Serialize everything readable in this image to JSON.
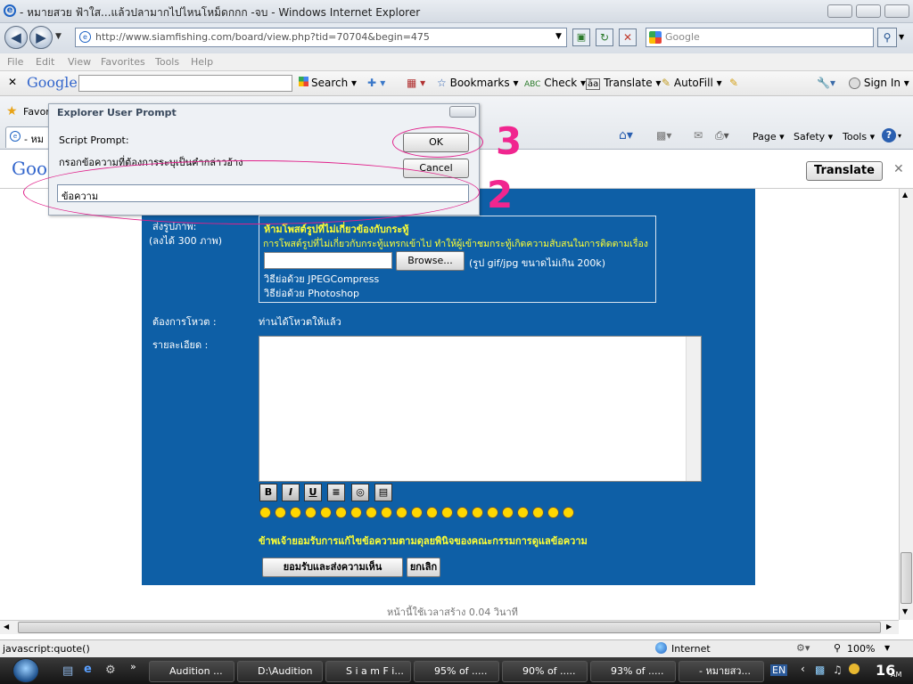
{
  "window": {
    "title": "- หมายสวย ฟ้าใส...แล้วปลามากไปไหนโหม็ดกกก -จบ - Windows Internet Explorer"
  },
  "address": {
    "url": "http://www.siamfishing.com/board/view.php?tid=70704&begin=475",
    "search_placeholder": "Google"
  },
  "menu": [
    "File",
    "Edit",
    "View",
    "Favorites",
    "Tools",
    "Help"
  ],
  "google_toolbar": {
    "logo": "Google",
    "search_label": "Search",
    "bookmarks_label": "Bookmarks",
    "check_label": "Check",
    "translate_label": "Translate",
    "autofill_label": "AutoFill",
    "signin_label": "Sign In"
  },
  "favorites_bar": {
    "favorites_label": "Favor",
    "tab_label": "- หม",
    "page_label": "Page",
    "safety_label": "Safety",
    "tools_label": "Tools"
  },
  "translate_bar": {
    "logo": "Goo",
    "button": "Translate"
  },
  "dialog": {
    "title": "Explorer User Prompt",
    "script_prompt": "Script Prompt:",
    "message": "กรอกข้อความที่ต้องการระบุเป็นคำกล่าวอ้าง",
    "input_value": "ข้อความ",
    "ok": "OK",
    "cancel": "Cancel"
  },
  "annotations": {
    "digit_ok": "3",
    "digit_input": "2"
  },
  "form": {
    "image_label": "ส่งรูปภาพ:",
    "image_limit": "(ลงได้ 300 ภาพ)",
    "warning_title": "ห้ามโพสต์รูปที่ไม่เกี่ยวข้องกับกระทู้",
    "warning_text": "การโพสต์รูปที่ไม่เกี่ยวกับกระทู้แทรกเข้าไป ทำให้ผู้เข้าชมกระทู้เกิดความสับสนในการติดตามเรื่อง",
    "browse_button": "Browse...",
    "file_hint": "(รูป gif/jpg ขนาดไม่เกิน 200k)",
    "resize_jpeg": "วิธีย่อด้วย JPEGCompress",
    "resize_photoshop": "วิธีย่อด้วย Photoshop",
    "vote_label": "ต้องการโหวต :",
    "vote_value": "ท่านได้โหวตให้แล้ว",
    "detail_label": "รายละเอียด :",
    "format_buttons": [
      "B",
      "I",
      "U",
      "≡",
      "◎",
      "▤"
    ],
    "emoji_count": 21,
    "agreement": "ข้าพเจ้ายอมรับการแก้ไขข้อความตามดุลยพินิจของคณะกรรมการดูแลข้อความ",
    "submit": "ยอมรับและส่งความเห็น",
    "cancel": "ยกเลิก"
  },
  "footer": {
    "render_time": "หน้านี้ใช้เวลาสร้าง 0.04 วินาที"
  },
  "status": {
    "left": "javascript:quote()",
    "zone": "Internet",
    "zoom": "100%"
  },
  "taskbar": {
    "items": [
      "Audition ...",
      "D:\\Audition",
      "S i a m F i...",
      "95% of .....",
      "90% of .....",
      "93% of .....",
      "- หมายสว..."
    ],
    "lang": "EN",
    "clock_time": "16",
    "clock_ampm": "AM"
  },
  "colors": {
    "page_blue": "#0e5fa6",
    "annotation_pink": "#f0268f",
    "yellow_text": "#ffff33"
  }
}
